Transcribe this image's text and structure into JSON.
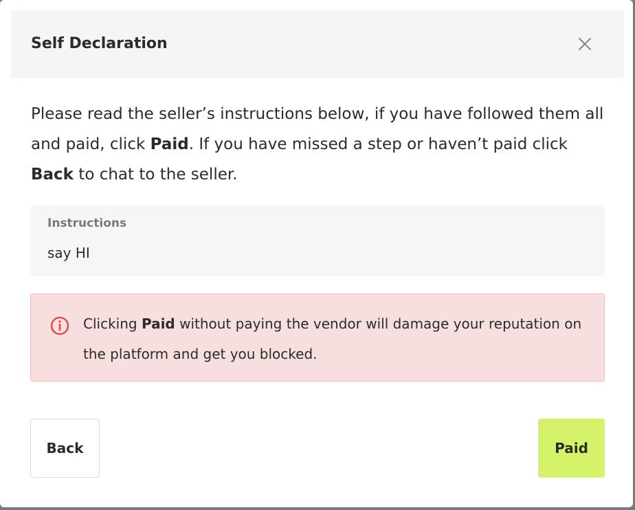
{
  "dialog": {
    "title": "Self Declaration",
    "close_icon": "close-icon"
  },
  "intro": {
    "part1": "Please read the seller’s instructions below, if you have followed them all and paid, click ",
    "paid_word": "Paid",
    "part2": ". If you have missed a step or haven’t paid click ",
    "back_word": "Back",
    "part3": " to chat to the seller."
  },
  "instructions": {
    "label": "Instructions",
    "value": "say HI"
  },
  "warning": {
    "icon": "info-circle-icon",
    "prefix": "Clicking ",
    "paid_word": "Paid",
    "suffix": " without paying the vendor will damage your reputation on the platform and get you blocked."
  },
  "buttons": {
    "back_label": "Back",
    "paid_label": "Paid"
  },
  "colors": {
    "paid_button": "#d4f26a",
    "warning_bg": "#f7dfe0",
    "warning_icon": "#e05050"
  }
}
